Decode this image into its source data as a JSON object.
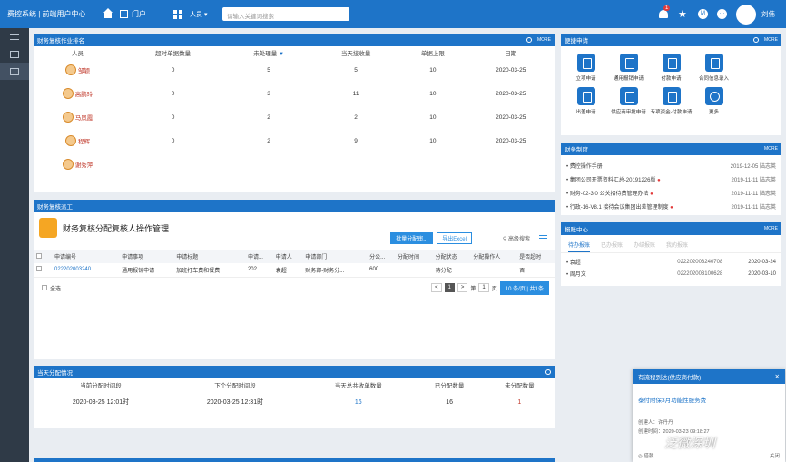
{
  "header": {
    "brand": "费控系统 | 前端用户中心",
    "portal": "门户",
    "search_type": "人员 ▾",
    "search_placeholder": "请输入关键词搜索",
    "notif_count": "1",
    "username": "刘伟"
  },
  "ranking": {
    "title": "财务复核作业排名",
    "more": "MORE",
    "columns": [
      "人员",
      "超时单据数量",
      "未处理量",
      "当天接收量",
      "单据上限",
      "日期"
    ],
    "rows": [
      {
        "name": "邹颖",
        "overtime": "0",
        "pending": "5",
        "received": "5",
        "limit": "10",
        "date": "2020-03-25"
      },
      {
        "name": "高鹏玲",
        "overtime": "0",
        "pending": "3",
        "received": "11",
        "limit": "10",
        "date": "2020-03-25"
      },
      {
        "name": "马凤霞",
        "overtime": "0",
        "pending": "2",
        "received": "2",
        "limit": "10",
        "date": "2020-03-25"
      },
      {
        "name": "程辉",
        "overtime": "0",
        "pending": "2",
        "received": "9",
        "limit": "10",
        "date": "2020-03-25"
      },
      {
        "name": "谢秀萍",
        "overtime": "",
        "pending": "",
        "received": "",
        "limit": "",
        "date": ""
      }
    ]
  },
  "review": {
    "title": "财务复核派工",
    "task_title": "财务复核分配复核人操作管理",
    "btn_batch": "批量分配审...",
    "btn_export": "导出Excel",
    "adv_search": "高级搜索",
    "columns": [
      "申请编号",
      "申请事项",
      "申请标题",
      "申请...",
      "申请人",
      "申请部门",
      "分公...",
      "分配时间",
      "分配状态",
      "分配操作人",
      "是否超时"
    ],
    "rows": [
      {
        "no": "022202003240...",
        "item": "通用报销申请",
        "title": "加班打车费和餐费",
        "date": "202...",
        "applicant": "袁超",
        "dept": "财务部-财务分...",
        "company": "600...",
        "time": "",
        "status": "待分配",
        "operator": "",
        "overtime": "否"
      }
    ],
    "select_all": "全选",
    "pager": {
      "prev": "<",
      "page": "1",
      "next": ">",
      "goto": "第",
      "goto_page": "1",
      "unit": "页",
      "size": "10 条/页 | 共1条"
    }
  },
  "today": {
    "title": "当天分配情况",
    "columns": [
      "当前分配时间段",
      "下个分配时间段",
      "当天总共收单数量",
      "已分配数量",
      "未分配数量"
    ],
    "row": {
      "current": "2020-03-25 12:01时",
      "next": "2020-03-25 12:31时",
      "total": "16",
      "assigned": "16",
      "unassigned": "1"
    }
  },
  "apps": {
    "title": "便捷申请",
    "items": [
      "立项申请",
      "通用报销申请",
      "付款申请",
      "合同信息录入",
      "出差申请",
      "供应商审批申请",
      "专项资金-付款申请",
      "更多"
    ]
  },
  "system": {
    "title": "财务制度",
    "items": [
      {
        "text": "费控操作手册",
        "date": "2019-12-05",
        "author": "陆志英",
        "dot": ""
      },
      {
        "text": "集团公司开票资料汇总-20191226版",
        "date": "2019-11-11",
        "author": "陆志英",
        "dot": "●"
      },
      {
        "text": "财务-02-3.0 公关招待费管理办法",
        "date": "2019-11-11",
        "author": "陆志英",
        "dot": "●"
      },
      {
        "text": "行政-16-V8.1 接待会议集团出差管理制度",
        "date": "2019-11-11",
        "author": "陆志英",
        "dot": "●"
      }
    ]
  },
  "reports": {
    "title": "报账中心",
    "tabs": [
      "待办报账",
      "已办报账",
      "办结报账",
      "我的报账"
    ],
    "items": [
      {
        "name": "袁超",
        "no": "022202003240708",
        "date": "2020-03-24"
      },
      {
        "name": "周月文",
        "no": "022202003100628",
        "date": "2020-03-10"
      }
    ]
  },
  "popup": {
    "title": "有流程到达(供应商付款)",
    "link": "泰付附保3月功能性服务费",
    "creator": "创建人：许丹丹",
    "created": "创建时间：2020-03-23 09:18:27",
    "foot_left": "◎ 借款",
    "foot_right": "关闭"
  },
  "watermark": "泛微深圳"
}
